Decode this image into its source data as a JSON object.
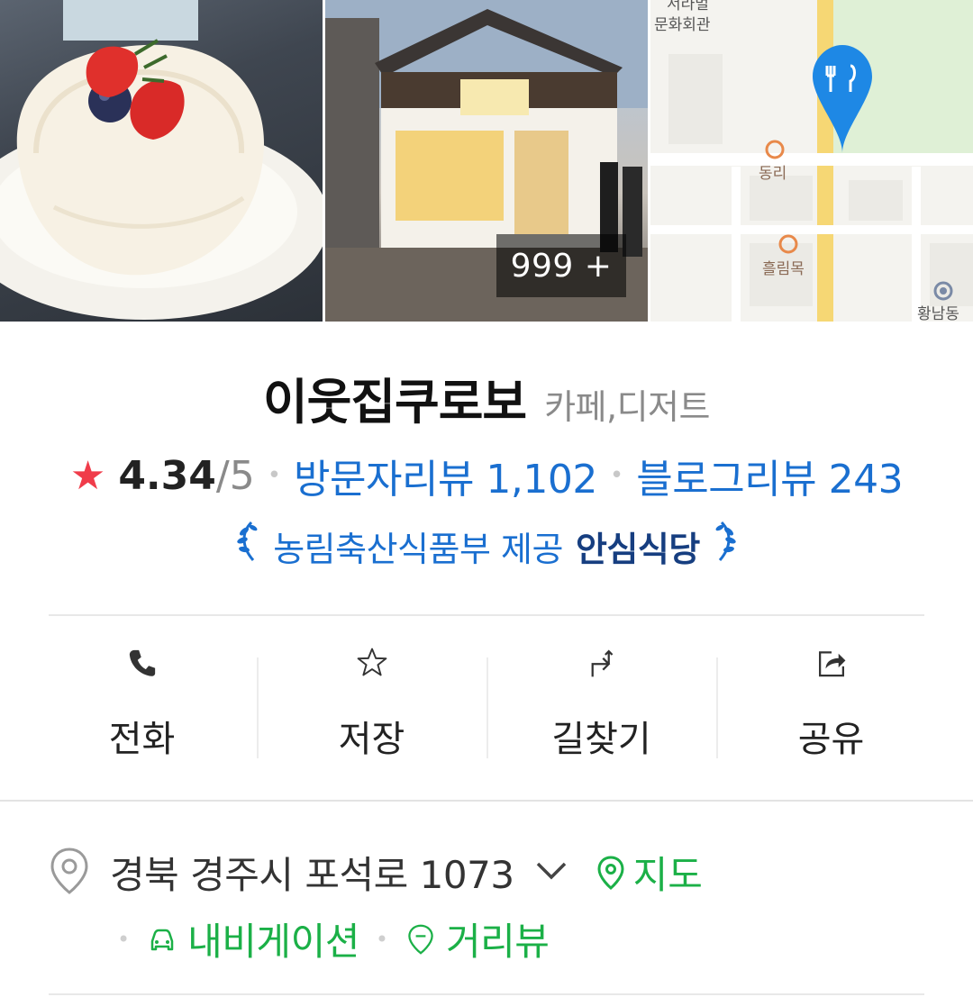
{
  "photos": {
    "count_badge": "999 +",
    "map_labels": [
      "서라벌",
      "문화회관",
      "동리",
      "흘림목",
      "황남동"
    ]
  },
  "place": {
    "name": "이웃집쿠로보",
    "category": "카페,디저트"
  },
  "rating": {
    "score": "4.34",
    "max": "/5",
    "visitor_reviews": "방문자리뷰 1,102",
    "blog_reviews": "블로그리뷰 243"
  },
  "certification": {
    "text": "농림축산식품부 제공",
    "strong": "안심식당"
  },
  "actions": [
    {
      "label": "전화",
      "icon": "phone-icon"
    },
    {
      "label": "저장",
      "icon": "star-outline-icon"
    },
    {
      "label": "길찾기",
      "icon": "directions-icon"
    },
    {
      "label": "공유",
      "icon": "share-icon"
    }
  ],
  "address": {
    "text": "경북 경주시 포석로 1073",
    "map_label": "지도",
    "navigation_label": "내비게이션",
    "street_view_label": "거리뷰"
  },
  "colors": {
    "link_blue": "#1a6fd0",
    "badge_dark": "#163e80",
    "green": "#1bb047",
    "star_red": "#f03c4a",
    "map_pin": "#1e88e5"
  }
}
